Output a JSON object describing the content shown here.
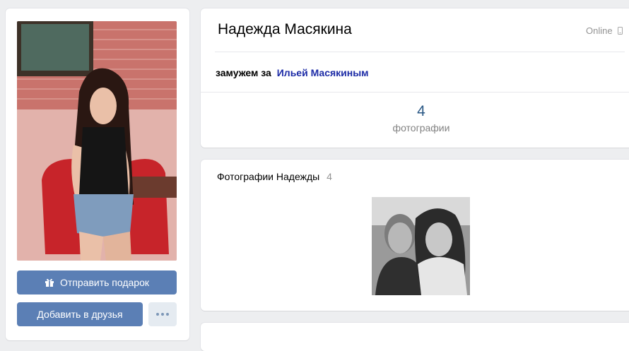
{
  "profile": {
    "name": "Надежда Масякина",
    "status": "Online",
    "relationship_prefix": "замужем за",
    "partner_name": "Ильей Масякиным"
  },
  "counters": {
    "photos_count": "4",
    "photos_label": "фотографии"
  },
  "actions": {
    "gift_label": "Отправить подарок",
    "add_friend_label": "Добавить в друзья",
    "more_icon": "more-dots-icon"
  },
  "photos_block": {
    "title": "Фотографии Надежды",
    "count": "4"
  },
  "colors": {
    "accent": "#5b7fb5",
    "link": "#1c2ba6",
    "background": "#edeef0"
  }
}
